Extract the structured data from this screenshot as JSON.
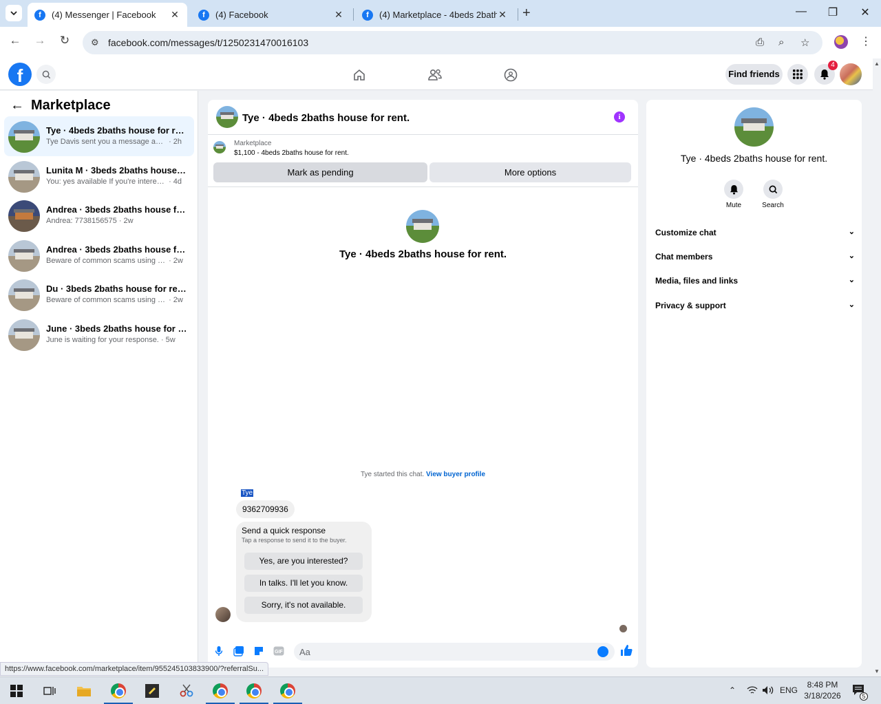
{
  "browser": {
    "tabs": [
      {
        "title": "(4) Messenger | Facebook",
        "active": true
      },
      {
        "title": "(4) Facebook",
        "active": false
      },
      {
        "title": "(4) Marketplace - 4beds 2baths",
        "active": false
      }
    ],
    "url": "facebook.com/messages/t/1250231470016103",
    "status_url": "https://www.facebook.com/marketplace/item/955245103833900/?referralSu..."
  },
  "fb_header": {
    "find_friends": "Find friends",
    "notification_count": "4"
  },
  "sidebar": {
    "title": "Marketplace",
    "conversations": [
      {
        "name": "Tye · 4beds 2baths house for rent.",
        "preview": "Tye Davis sent you a message about y...",
        "time": "· 2h",
        "selected": true
      },
      {
        "name": "Lunita M · 3beds 2baths house for ...",
        "preview": "You: yes available If you're interested i...",
        "time": "· 4d",
        "selected": false
      },
      {
        "name": "Andrea · 3beds 2baths house for r...",
        "preview": "Andrea: 7738156575",
        "time": "· 2w",
        "selected": false
      },
      {
        "name": "Andrea · 3beds 2baths house for r...",
        "preview": "Beware of common scams using pay...",
        "time": "· 2w",
        "selected": false
      },
      {
        "name": "Du · 3beds 2baths house for rent .",
        "preview": "Beware of common scams using pay...",
        "time": "· 2w",
        "selected": false
      },
      {
        "name": "June · 3beds 2baths house for rent .",
        "preview": "June is waiting for your response.",
        "time": "· 5w",
        "selected": false
      }
    ]
  },
  "chat": {
    "title": "Tye · 4beds 2baths house for rent.",
    "marketplace_label": "Marketplace",
    "listing": "$1,100 - 4beds 2baths house for rent.",
    "mark_pending": "Mark as pending",
    "more_options": "More options",
    "intro_name": "Tye · 4beds 2baths house for rent.",
    "started_text": "Tye started this chat.",
    "view_buyer": "View buyer profile",
    "sender": "Tye",
    "message": "9362709936",
    "quick_title": "Send a quick response",
    "quick_sub": "Tap a response to send it to the buyer.",
    "quick_replies": [
      "Yes, are you interested?",
      "In talks. I'll let you know.",
      "Sorry, it's not available."
    ],
    "composer_placeholder": "Aa"
  },
  "info_panel": {
    "name": "Tye · 4beds 2baths house for rent.",
    "mute": "Mute",
    "search": "Search",
    "sections": [
      "Customize chat",
      "Chat members",
      "Media, files and links",
      "Privacy & support"
    ]
  },
  "taskbar": {
    "lang": "ENG",
    "time": "8:48 PM",
    "date": "3/18/2026",
    "notif_count": "5"
  },
  "colors": {
    "fb_blue": "#1877f2",
    "selected_bg": "#ebf5ff",
    "info_purple": "#a033ff",
    "badge_red": "#e41e3f"
  }
}
